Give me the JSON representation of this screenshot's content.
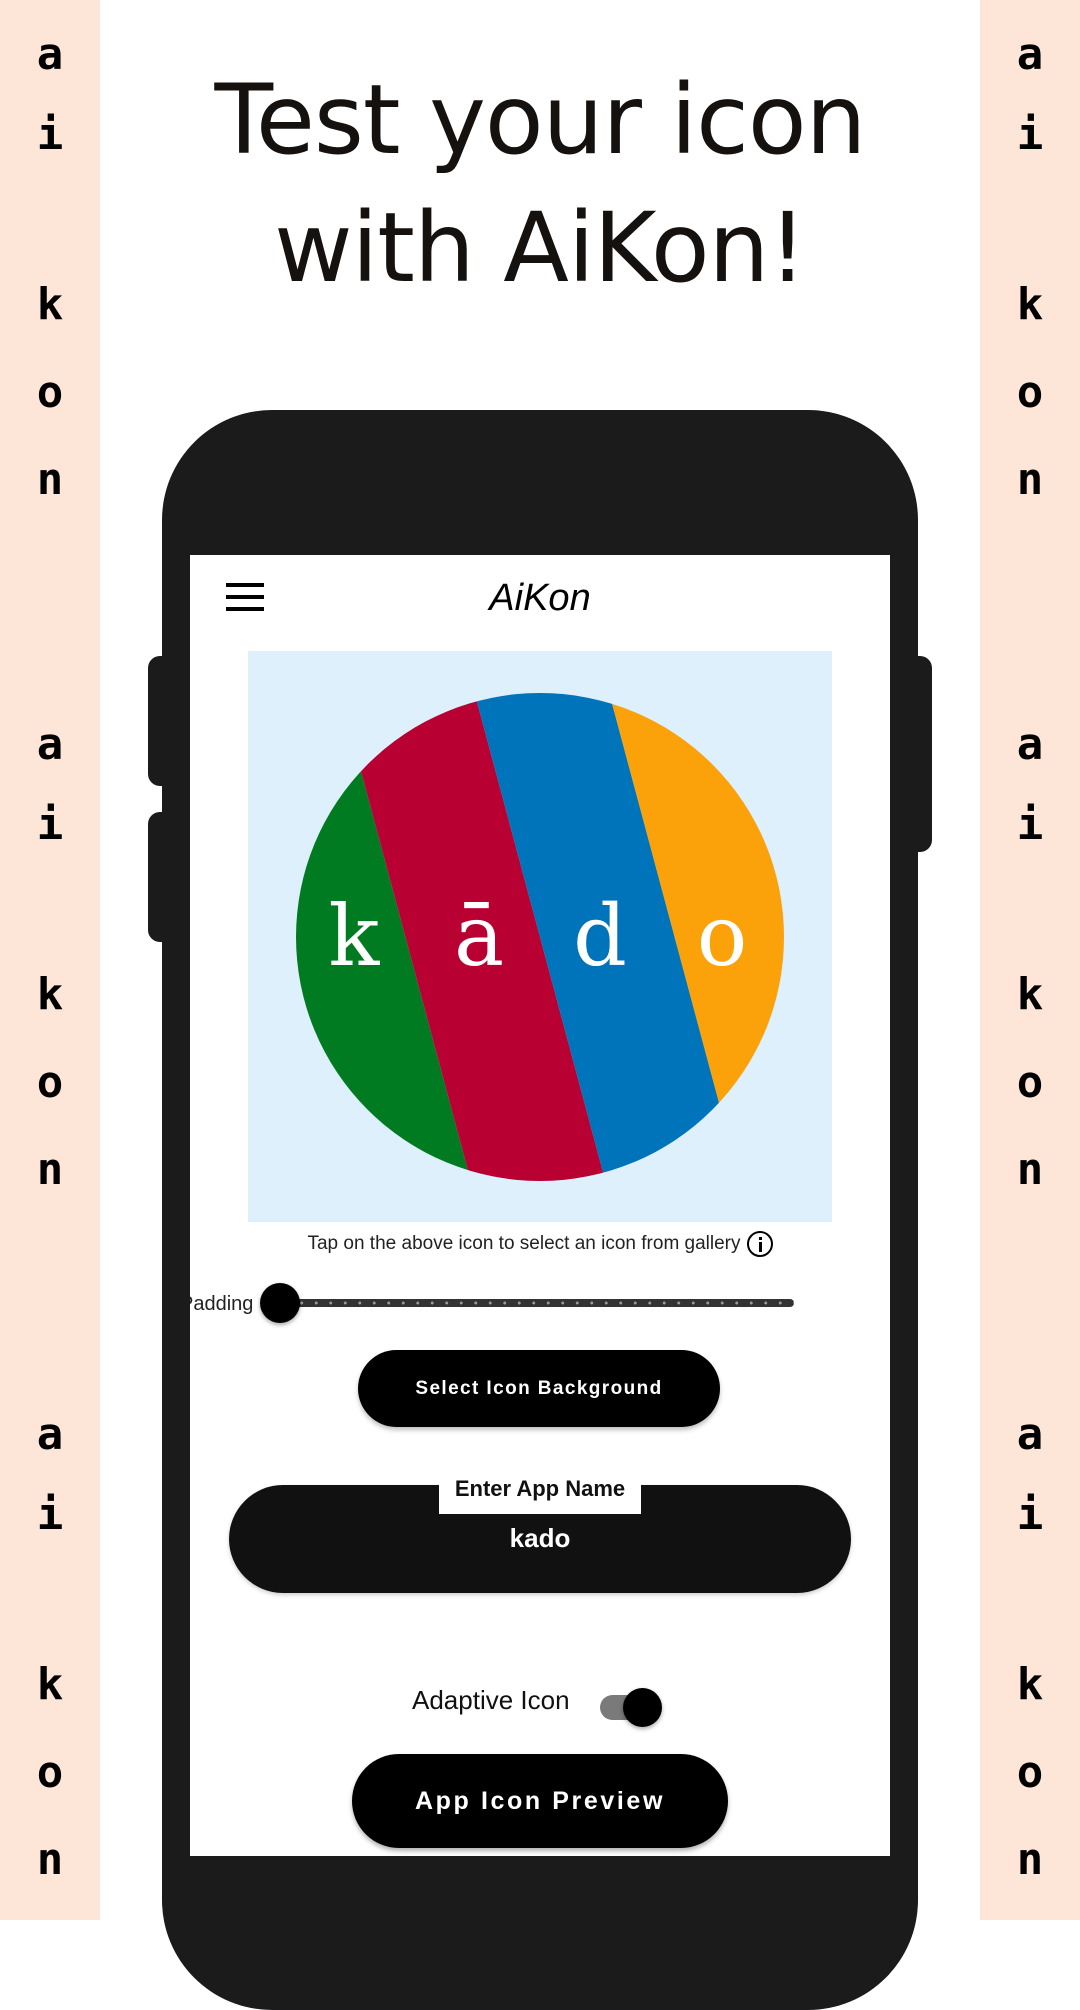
{
  "promo": {
    "headline_line1": "Test your icon",
    "headline_line2": "with AiKon!",
    "background_color": "#fde5d8",
    "side_letters": [
      "a",
      "i",
      "k",
      "o",
      "n"
    ]
  },
  "app": {
    "title": "AiKon",
    "menu_icon": "hamburger-menu-icon"
  },
  "icon_preview": {
    "background_color": "#def0fb",
    "stripes": [
      {
        "color": "#007b22",
        "letter": "k"
      },
      {
        "color": "#b80032",
        "letter": "ā"
      },
      {
        "color": "#0074bb",
        "letter": "d"
      },
      {
        "color": "#fba20b",
        "letter": "o"
      }
    ],
    "hint_text": "Tap on the above icon to select an icon from gallery",
    "hint_icon": "info-icon"
  },
  "padding_slider": {
    "label": "Padding",
    "value": 0,
    "min": 0,
    "max": 100
  },
  "buttons": {
    "select_background": "Select Icon Background",
    "app_icon_preview": "App Icon Preview"
  },
  "app_name_field": {
    "label": "Enter App Name",
    "value": "kado"
  },
  "adaptive_icon": {
    "label": "Adaptive Icon",
    "enabled": true
  }
}
